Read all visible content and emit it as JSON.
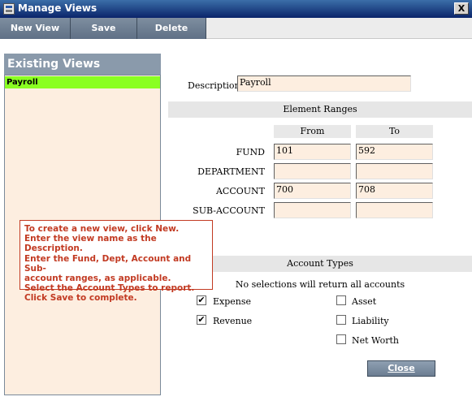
{
  "window": {
    "title": "Manage Views",
    "close_glyph": "X"
  },
  "toolbar": {
    "new_view": "New View",
    "save": "Save",
    "delete": "Delete"
  },
  "existing_views": {
    "header": "Existing Views",
    "items": [
      "Payroll"
    ],
    "selected": "Payroll",
    "selected_color": "#8aff22"
  },
  "description": {
    "label": "Description",
    "value": "Payroll"
  },
  "element_ranges": {
    "header": "Element Ranges",
    "from_label": "From",
    "to_label": "To",
    "rows": [
      {
        "label": "FUND",
        "from": "101",
        "to": "592"
      },
      {
        "label": "DEPARTMENT",
        "from": "",
        "to": ""
      },
      {
        "label": "ACCOUNT",
        "from": "700",
        "to": "708"
      },
      {
        "label": "SUB-ACCOUNT",
        "from": "",
        "to": ""
      }
    ]
  },
  "account_types": {
    "header": "Account Types",
    "note": "No selections will return all accounts",
    "items": [
      {
        "label": "Expense",
        "checked": true
      },
      {
        "label": "Revenue",
        "checked": true
      },
      {
        "label": "Asset",
        "checked": false
      },
      {
        "label": "Liability",
        "checked": false
      },
      {
        "label": "Net Worth",
        "checked": false
      }
    ]
  },
  "instructions": [
    "To create a new view, click New.",
    "Enter the view name as the Description.",
    "Enter the Fund, Dept, Account and Sub-",
    "account ranges, as applicable.",
    "Select the Account Types to report.",
    "Click Save to complete."
  ],
  "close_button": "Close",
  "check_glyph": "✔"
}
